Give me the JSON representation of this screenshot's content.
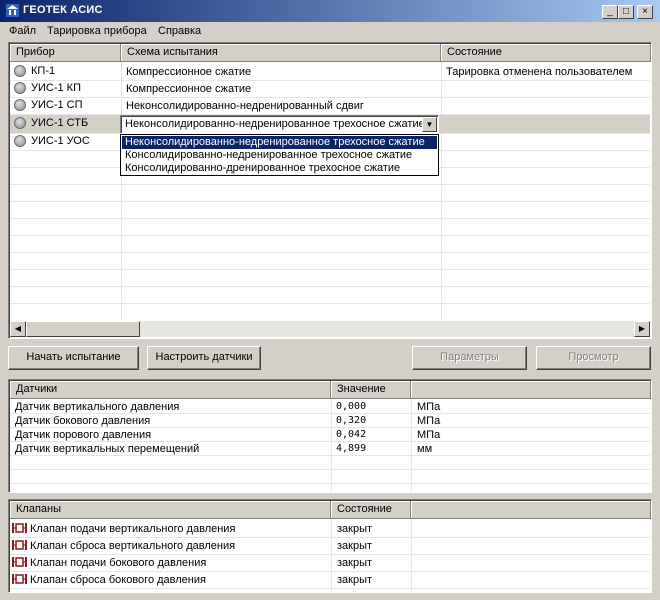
{
  "window": {
    "title": "ГЕОТЕК АСИС",
    "min": "_",
    "max": "□",
    "close": "×"
  },
  "menu": [
    "Файл",
    "Тарировка прибора",
    "Справка"
  ],
  "devices": {
    "columns": [
      "Прибор",
      "Схема испытания",
      "Состояние"
    ],
    "rows": [
      {
        "device": "КП-1",
        "scheme": "Компрессионное сжатие",
        "status": "Тарировка отменена пользователем"
      },
      {
        "device": "УИС-1 КП",
        "scheme": "Компрессионное сжатие",
        "status": ""
      },
      {
        "device": "УИС-1 СП",
        "scheme": "Неконсолидированно-недренированный сдвиг",
        "status": ""
      },
      {
        "device": "УИС-1 СТБ",
        "scheme": "",
        "status": ""
      },
      {
        "device": "УИС-1 УОС",
        "scheme": "",
        "status": ""
      }
    ],
    "combo_value": "Неконсолидированно-недренированное трехосное сжатие",
    "dropdown_options": [
      "Неконсолидированно-недренированное трехосное сжатие",
      "Консолидированно-недренированное трехосное сжатие",
      "Консолидированно-дренированное трехосное сжатие"
    ]
  },
  "buttons": {
    "start": "Начать испытание",
    "sensors": "Настроить датчики",
    "params": "Параметры",
    "view": "Просмотр"
  },
  "sensors": {
    "columns": [
      "Датчики",
      "Значение"
    ],
    "rows": [
      {
        "name": "Датчик вертикального давления",
        "value": "0,000",
        "unit": "МПа"
      },
      {
        "name": "Датчик бокового давления",
        "value": "0,320",
        "unit": "МПа"
      },
      {
        "name": "Датчик порового давления",
        "value": "0,042",
        "unit": "МПа"
      },
      {
        "name": "Датчик вертикальных перемещений",
        "value": "4,899",
        "unit": "мм"
      }
    ]
  },
  "valves": {
    "columns": [
      "Клапаны",
      "Состояние"
    ],
    "rows": [
      {
        "name": "Клапан подачи вертикального давления",
        "state": "закрыт"
      },
      {
        "name": "Клапан сброса вертикального давления",
        "state": "закрыт"
      },
      {
        "name": "Клапан подачи бокового давления",
        "state": "закрыт"
      },
      {
        "name": "Клапан сброса бокового давления",
        "state": "закрыт"
      }
    ]
  },
  "colors": {
    "title_start": "#0a246a",
    "title_end": "#a6caf0",
    "selection": "#0a246a",
    "valve": "#8b1a1a"
  }
}
